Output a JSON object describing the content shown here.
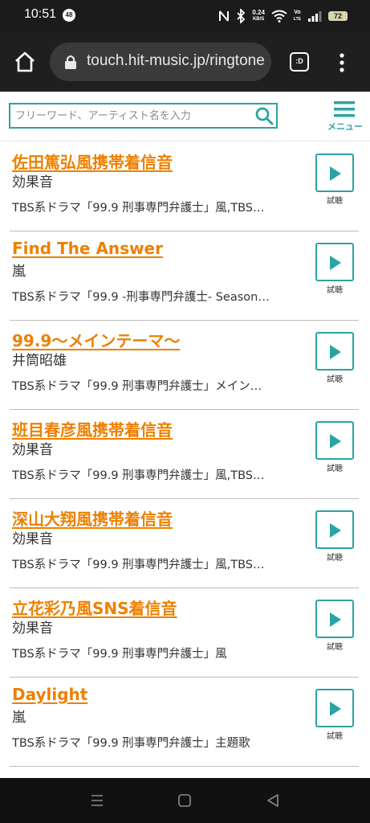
{
  "status_bar": {
    "time": "10:51",
    "notification_count": "48",
    "net_speed_value": "0.24",
    "net_speed_unit": "KB/S",
    "volte_top": "Vo",
    "volte_bottom": "LTE",
    "battery": "72"
  },
  "browser": {
    "url": "touch.hit-music.jp/ringtone",
    "tab_label": ":D"
  },
  "header": {
    "search_placeholder": "フリーワード、アーティスト名を入力",
    "menu_label": "メニュー",
    "accent_color": "#2aa4a2"
  },
  "songs": [
    {
      "title": "佐田篤弘風携帯着信音",
      "artist": "効果音",
      "description": "TBS系ドラマ「99.9 刑事専門弁護士」風,TBS…",
      "listen_label": "試聴"
    },
    {
      "title": "Find The Answer",
      "artist": "嵐",
      "description": "TBS系ドラマ「99.9 -刑事専門弁護士- Season…",
      "listen_label": "試聴"
    },
    {
      "title": "99.9〜メインテーマ〜",
      "artist": "井筒昭雄",
      "description": "TBS系ドラマ「99.9 刑事専門弁護士」メイン…",
      "listen_label": "試聴"
    },
    {
      "title": "班目春彦風携帯着信音",
      "artist": "効果音",
      "description": "TBS系ドラマ「99.9 刑事専門弁護士」風,TBS…",
      "listen_label": "試聴"
    },
    {
      "title": "深山大翔風携帯着信音",
      "artist": "効果音",
      "description": "TBS系ドラマ「99.9 刑事専門弁護士」風,TBS…",
      "listen_label": "試聴"
    },
    {
      "title": "立花彩乃風SNS着信音",
      "artist": "効果音",
      "description": "TBS系ドラマ「99.9 刑事専門弁護士」風",
      "listen_label": "試聴"
    },
    {
      "title": "Daylight",
      "artist": "嵐",
      "description": "TBS系ドラマ「99.9 刑事専門弁護士」主題歌",
      "listen_label": "試聴"
    }
  ],
  "colors": {
    "title_link": "#ee8000",
    "accent": "#2aa4a2"
  }
}
